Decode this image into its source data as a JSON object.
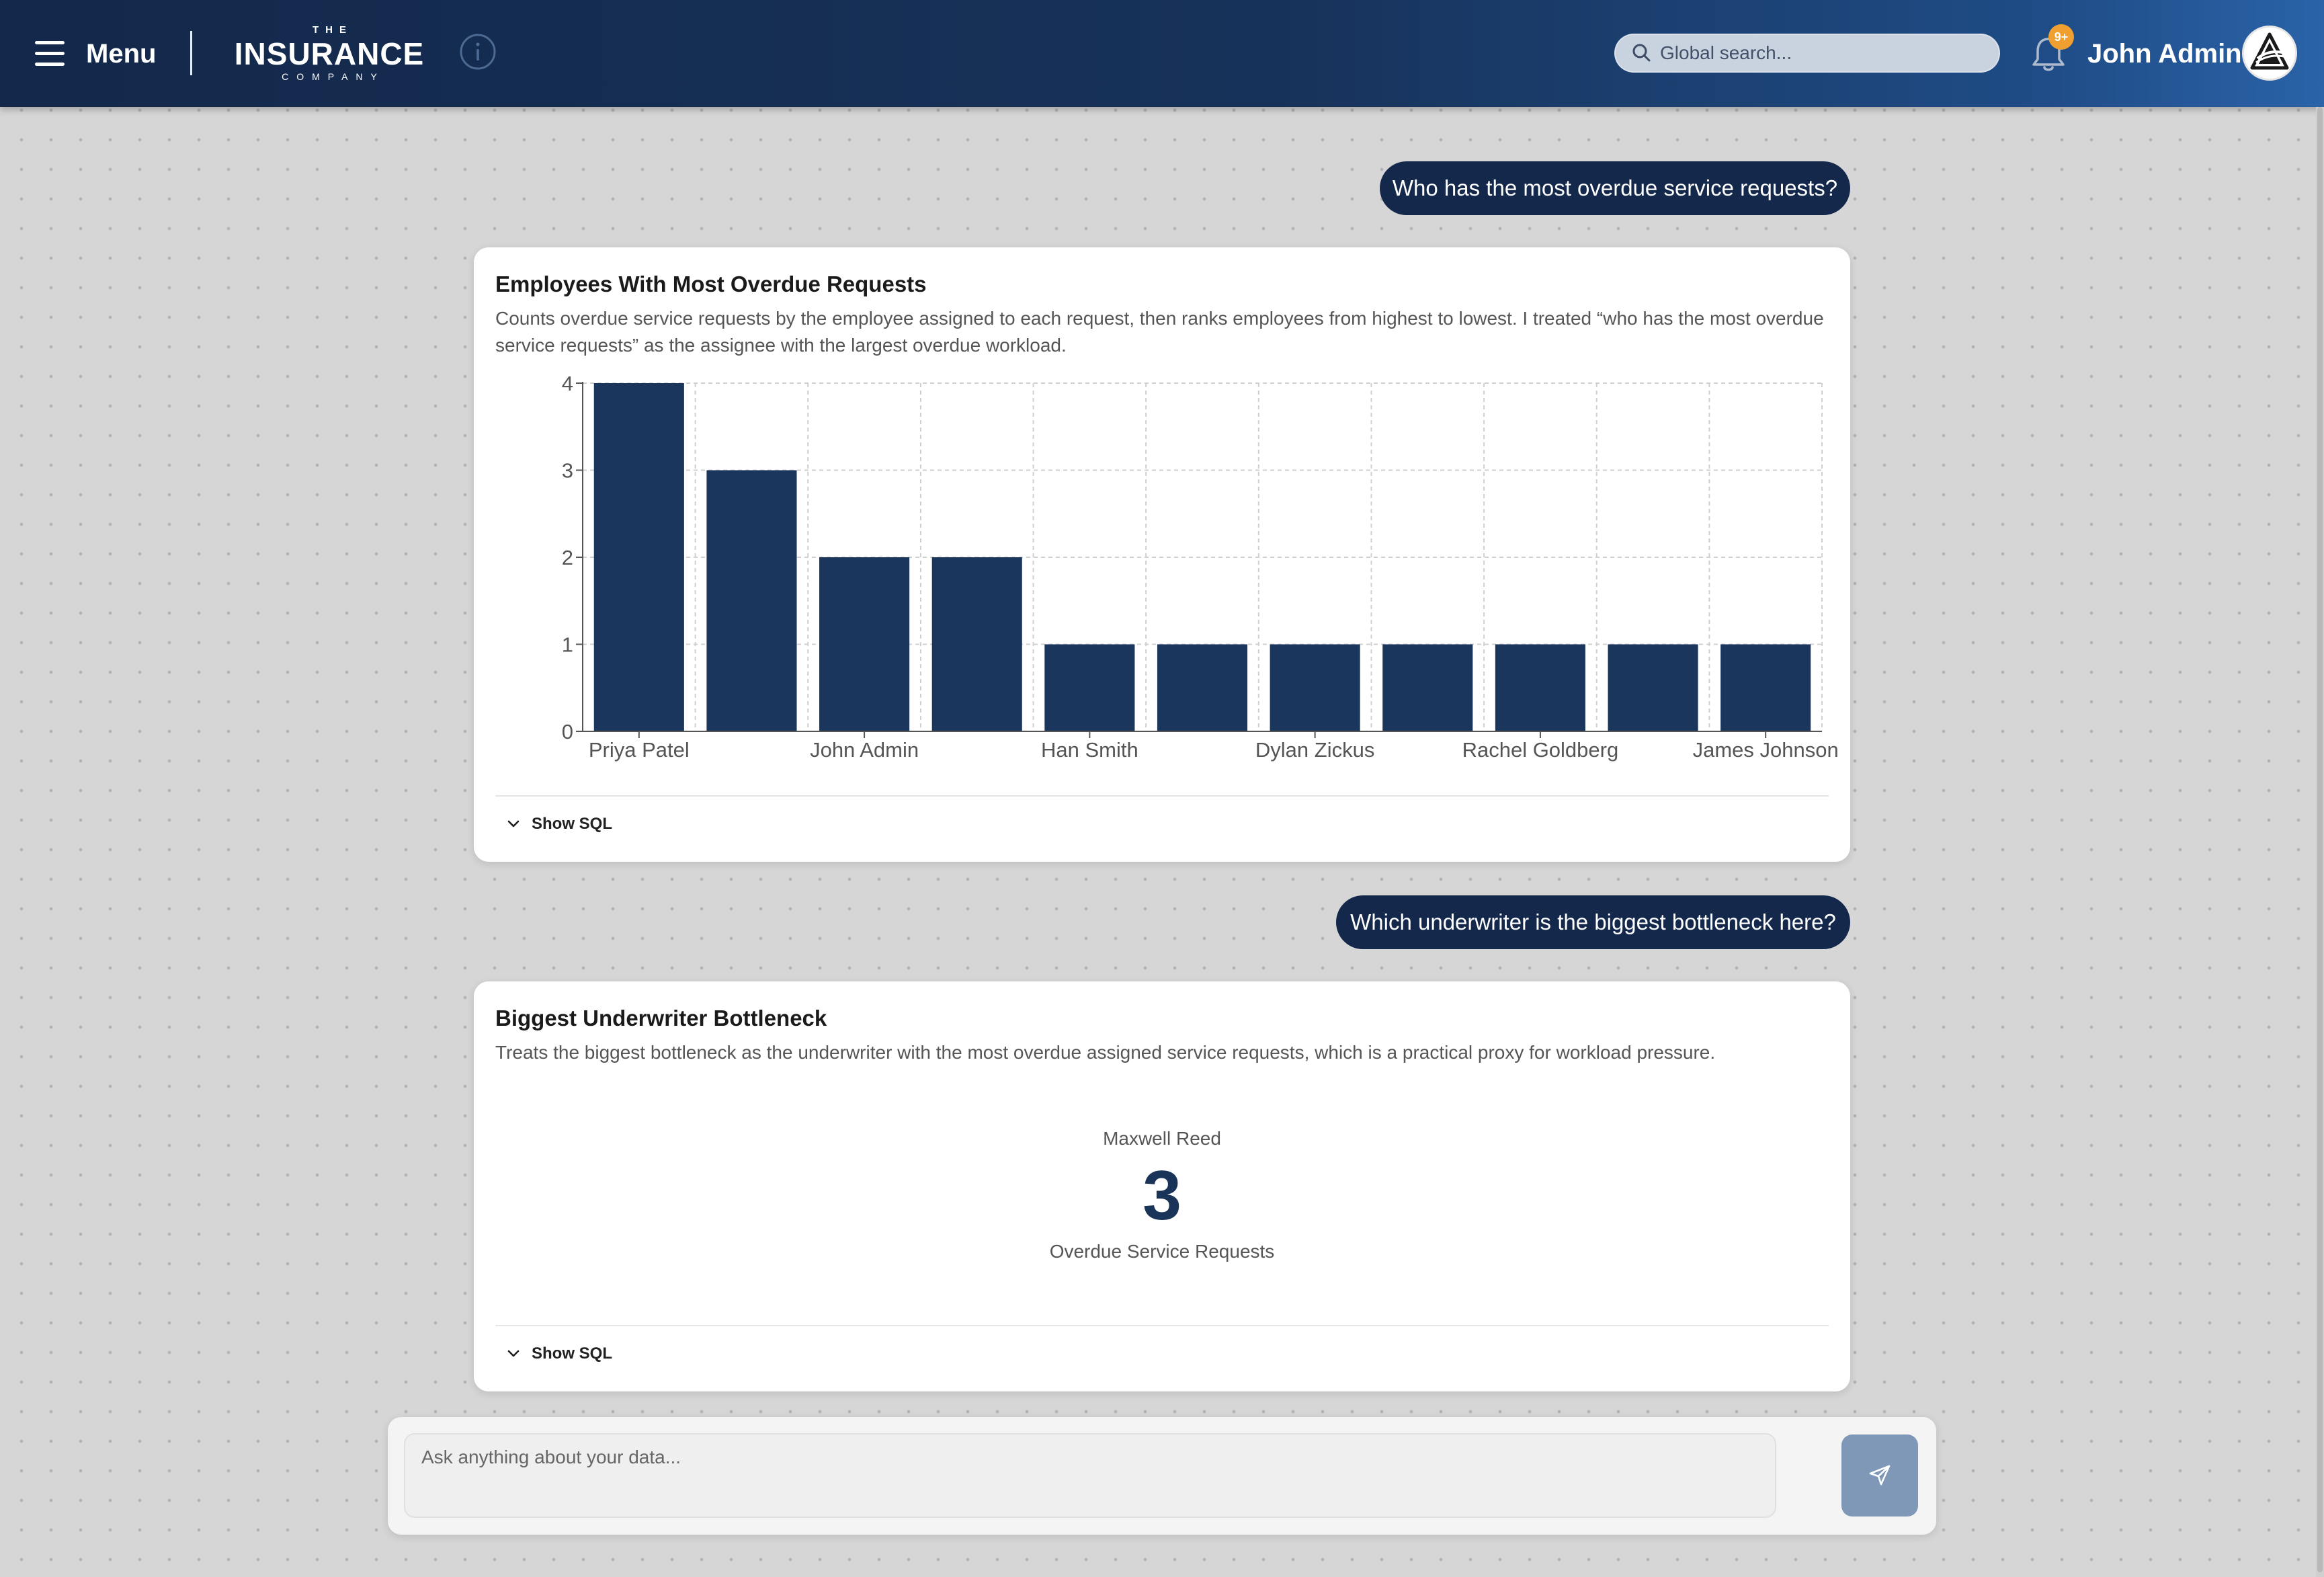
{
  "header": {
    "menu_label": "Menu",
    "logo": {
      "top": "THE",
      "main": "INSURANCE",
      "bottom": "COMPANY"
    },
    "search_placeholder": "Global search...",
    "notification_badge": "9+",
    "user_name": "John Admin"
  },
  "conversation": [
    {
      "question": "Who has the most overdue service requests?",
      "card": {
        "title": "Employees With Most Overdue Requests",
        "description": "Counts overdue service requests by the employee assigned to each request, then ranks employees from highest to lowest. I treated “who has the most overdue service requests” as the assignee with the largest overdue workload.",
        "show_sql_label": "Show SQL"
      }
    },
    {
      "question": "Which underwriter is the biggest bottleneck here?",
      "card": {
        "title": "Biggest Underwriter Bottleneck",
        "description": "Treats the biggest bottleneck as the underwriter with the most overdue assigned service requests, which is a practical proxy for workload pressure.",
        "metric_name": "Maxwell Reed",
        "metric_value": "3",
        "metric_caption": "Overdue Service Requests",
        "show_sql_label": "Show SQL"
      }
    }
  ],
  "chart_data": {
    "type": "bar",
    "categories": [
      "Priya Patel",
      "",
      "John Admin",
      "",
      "Han Smith",
      "",
      "Dylan Zickus",
      "",
      "Rachel Goldberg",
      "",
      "James Johnson"
    ],
    "values": [
      4,
      3,
      2,
      2,
      1,
      1,
      1,
      1,
      1,
      1,
      1
    ],
    "ylim": [
      0,
      4
    ],
    "yticks": [
      0,
      1,
      2,
      3,
      4
    ],
    "grid": true,
    "bar_color": "#1b365d"
  },
  "composer": {
    "placeholder": "Ask anything about your data..."
  },
  "colors": {
    "header_dark": "#13284a",
    "accent": "#1b365d",
    "badge": "#f0a030",
    "send_button": "#7f98b8"
  },
  "icons": {
    "menu": "hamburger-icon",
    "info": "info-icon",
    "search": "search-icon",
    "notifications": "bell-icon",
    "avatar": "user-avatar",
    "show_sql": "chevron-down-icon",
    "send": "send-icon"
  }
}
